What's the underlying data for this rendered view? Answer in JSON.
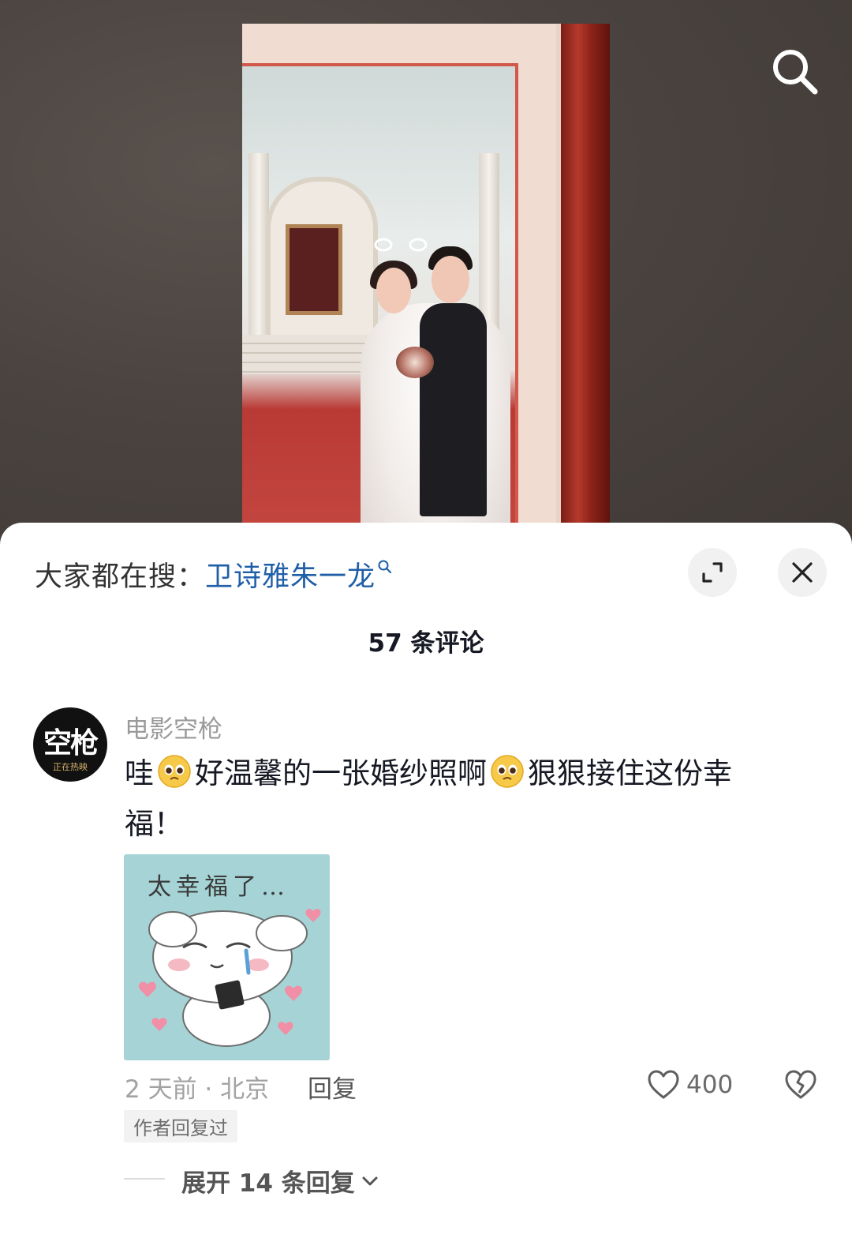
{
  "video": {
    "search_icon": "search-icon"
  },
  "sheet": {
    "hot_search_prefix": "大家都在搜：",
    "hot_search_keyword": "卫诗雅朱一龙",
    "comment_count_title": "57 条评论"
  },
  "comment": {
    "username": "电影空枪",
    "avatar_text": "空枪",
    "avatar_subtext": "正在热映",
    "text_part1": "哇",
    "text_part2": "好温馨的一张婚纱照啊",
    "text_part3": "狠狠接住这份幸福！",
    "sticker_text": "太幸福了…",
    "time_location": "2 天前 · 北京",
    "reply_label": "回复",
    "like_count": "400",
    "author_badge": "作者回复过",
    "expand_replies": "展开 14 条回复"
  },
  "colors": {
    "keyword": "#1f5fa8",
    "text": "#161823",
    "muted": "#a2a2a2"
  }
}
